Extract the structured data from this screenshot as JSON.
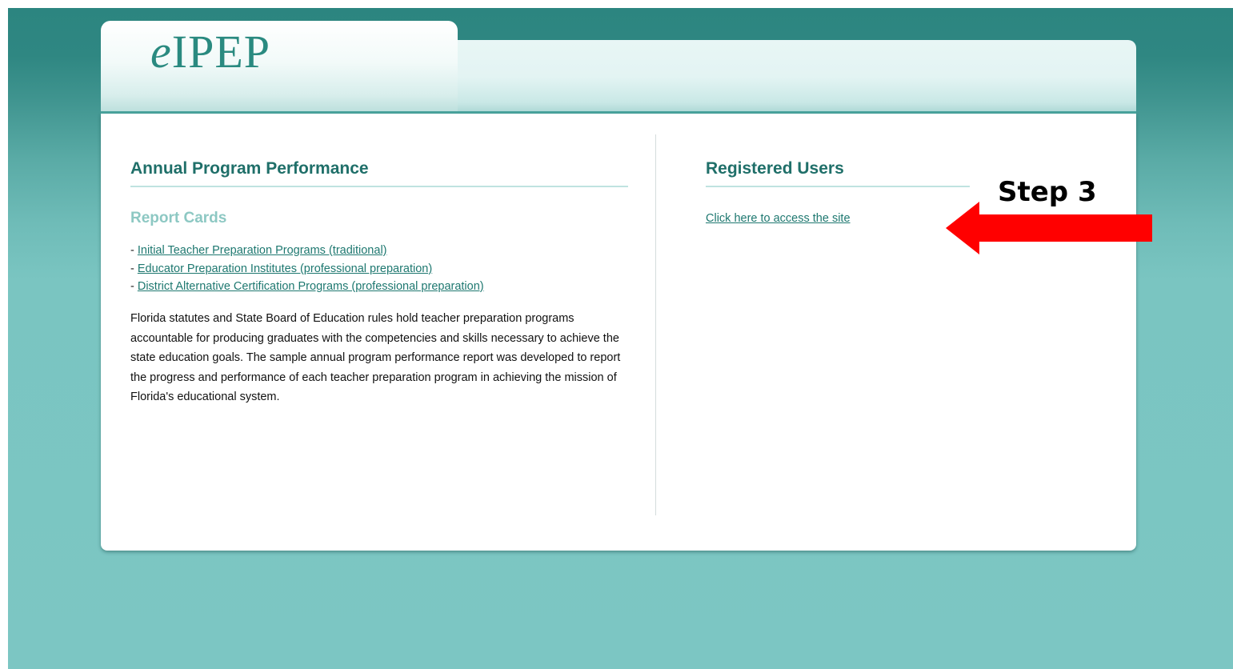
{
  "header": {
    "logo_prefix": "e",
    "logo_rest": "IPEP"
  },
  "left_column": {
    "title": "Annual Program Performance",
    "subheading": "Report Cards",
    "report_links": [
      {
        "bullet": "- ",
        "label": "Initial Teacher Preparation Programs (traditional)"
      },
      {
        "bullet": "- ",
        "label": "Educator Preparation Institutes (professional preparation)"
      },
      {
        "bullet": "- ",
        "label": "District Alternative Certification Programs (professional preparation)"
      }
    ],
    "description": "Florida statutes and State Board of Education rules hold teacher preparation programs accountable for producing graduates with the competencies and skills necessary to achieve the state education goals. The sample annual program performance report was developed to report the progress and performance of each teacher preparation program in achieving the mission of Florida's educational system."
  },
  "right_column": {
    "title": "Registered Users",
    "access_link": "Click here to access the site"
  },
  "annotation": {
    "step_label": "Step 3",
    "arrow_color": "#ff0000"
  },
  "colors": {
    "background_teal": "#7cc6c3",
    "header_dark_teal": "#2c8580",
    "title_teal": "#1f6f69",
    "subheading_teal": "#8dc8c3",
    "link_teal": "#1e7870"
  }
}
